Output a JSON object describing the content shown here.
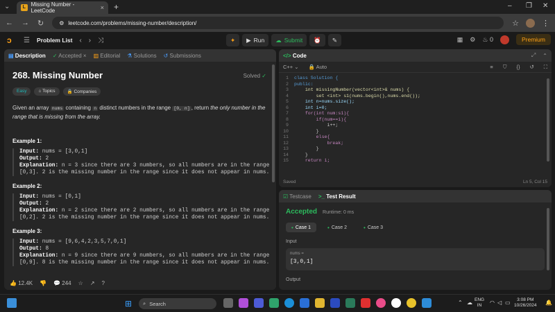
{
  "browser": {
    "tab_title": "Missing Number - LeetCode",
    "tab_close": "×",
    "new_tab": "+",
    "url": "leetcode.com/problems/missing-number/description/"
  },
  "lcnav": {
    "problem_list": "Problem List",
    "run": "Run",
    "submit": "Submit",
    "streak": "0",
    "premium": "Premium"
  },
  "desc_tabs": {
    "description": "Description",
    "accepted": "Accepted",
    "editorial": "Editorial",
    "solutions": "Solutions",
    "submissions": "Submissions"
  },
  "problem": {
    "title": "268. Missing Number",
    "status": "Solved",
    "tags": [
      "Easy",
      "Topics",
      "Companies"
    ],
    "statement_1": "Given an array ",
    "statement_code1": "nums",
    "statement_2": " containing ",
    "statement_code2": "n",
    "statement_3": " distinct numbers in the range ",
    "statement_code3": "[0, n]",
    "statement_4": ", return ",
    "statement_5": "the only number in the range that is missing from the array.",
    "examples": [
      {
        "heading": "Example 1:",
        "input": " nums = [3,0,1]",
        "output": " 2",
        "explanation": " n = 3 since there are 3 numbers, so all numbers are in the range\n[0,3]. 2 is the missing number in the range since it does not appear in nums."
      },
      {
        "heading": "Example 2:",
        "input": " nums = [0,1]",
        "output": " 2",
        "explanation": " n = 2 since there are 2 numbers, so all numbers are in the range\n[0,2]. 2 is the missing number in the range since it does not appear in nums."
      },
      {
        "heading": "Example 3:",
        "input": " nums = [9,6,4,2,3,5,7,0,1]",
        "output": " 8",
        "explanation": " n = 9 since there are 9 numbers, so all numbers are in the range\n[0,9]. 8 is the missing number in the range since it does not appear in nums."
      }
    ],
    "labels": {
      "input": "Input:",
      "output": "Output:",
      "explanation": "Explanation:"
    }
  },
  "desc_footer": {
    "likes": "12.4K",
    "comments": "244"
  },
  "code_panel": {
    "title": "Code",
    "language": "C++",
    "mode": "Auto",
    "status": "Saved",
    "cursor": "Ln 5, Col 15",
    "lines": [
      "class Solution {",
      "public:",
      "    int missingNumber(vector<int>& nums) {",
      "        set <int> s1(nums.begin(),nums.end());",
      "    int n=nums.size();",
      "    int i=0;",
      "    for(int num:s1){",
      "        if(num==i){",
      "            i++;",
      "        }",
      "        else{",
      "            break;",
      "        }",
      "    }",
      "    return i;"
    ]
  },
  "result_panel": {
    "tab_testcase": "Testcase",
    "tab_result": "Test Result",
    "verdict": "Accepted",
    "runtime": "Runtime: 0 ms",
    "cases": [
      "Case 1",
      "Case 2",
      "Case 3"
    ],
    "input_label": "Input",
    "var_name": "nums =",
    "var_value": "[3,0,1]",
    "output_label": "Output"
  },
  "taskbar": {
    "search_placeholder": "Search",
    "lang_1": "ENG",
    "lang_2": "IN",
    "time": "3:08 PM",
    "date": "10/26/2024"
  },
  "colors": {
    "accent": "#ffa116",
    "success": "#2cbb5d",
    "easy": "#1cbaba"
  }
}
